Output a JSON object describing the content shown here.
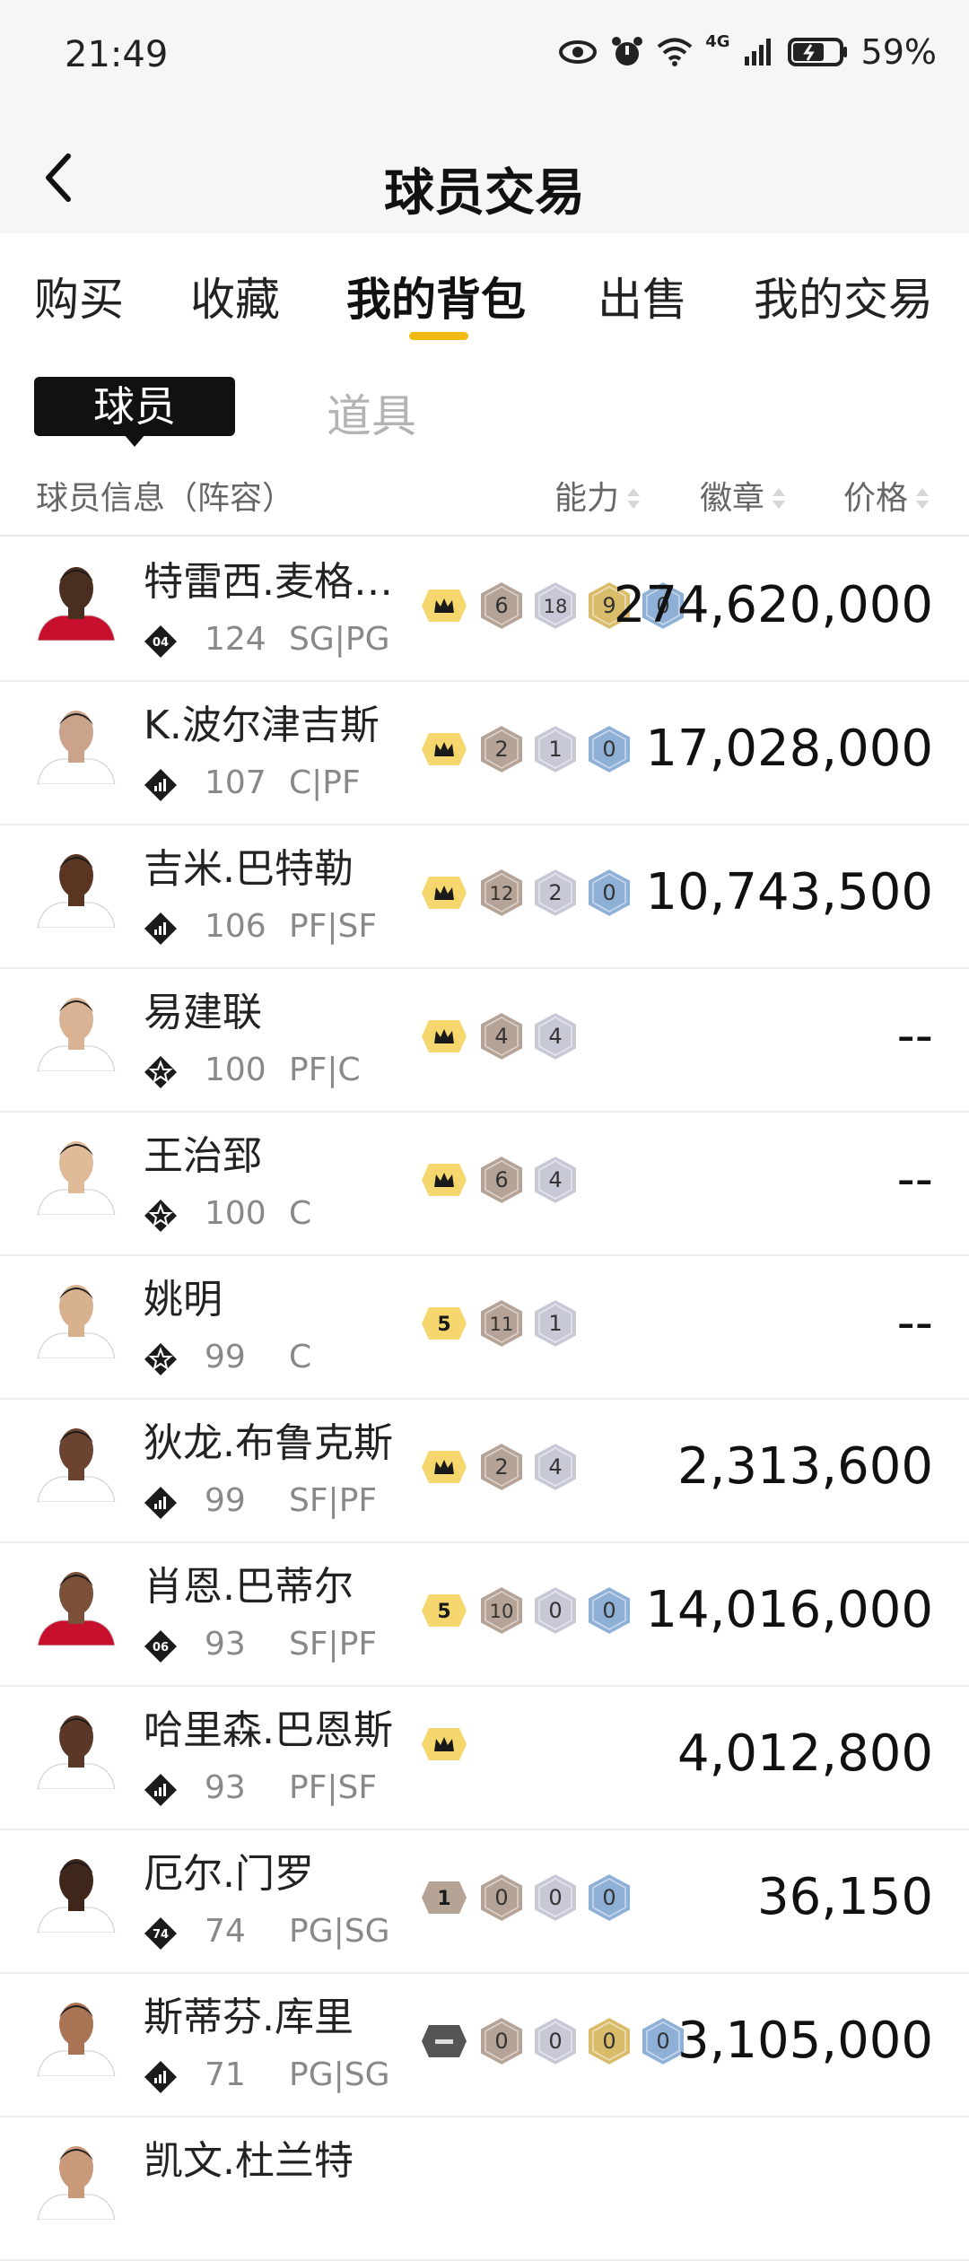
{
  "status_bar": {
    "time": "21:49",
    "battery": "59%",
    "network": "4G"
  },
  "header": {
    "title": "球员交易"
  },
  "tabs": [
    "购买",
    "收藏",
    "我的背包",
    "出售",
    "我的交易"
  ],
  "active_tab": 2,
  "segments": {
    "active": "球员",
    "inactive": "道具"
  },
  "columns": {
    "info": "球员信息（阵容）",
    "ability": "能力",
    "badge": "徽章",
    "price": "价格"
  },
  "colors": {
    "accent": "#f2b911",
    "bronze": "#b5a395",
    "silver": "#c7c9d6",
    "gold": "#d9bc6a",
    "blue": "#8fb0d6"
  },
  "players": [
    {
      "name": "特雷西.麦格雷...",
      "rating": "124",
      "pos": "SG|PG",
      "tier": "04",
      "lead": "crown",
      "badges": [
        {
          "t": "bronze",
          "n": "6"
        },
        {
          "t": "silver",
          "n": "18"
        },
        {
          "t": "gold",
          "n": "9"
        },
        {
          "t": "blue",
          "n": "0"
        }
      ],
      "price": "274,620,000"
    },
    {
      "name": "K.波尔津吉斯",
      "rating": "107",
      "pos": "C|PF",
      "tier": "bars",
      "lead": "crown",
      "badges": [
        {
          "t": "bronze",
          "n": "2"
        },
        {
          "t": "silver",
          "n": "1"
        },
        {
          "t": "blue",
          "n": "0"
        }
      ],
      "price": "17,028,000"
    },
    {
      "name": "吉米.巴特勒",
      "rating": "106",
      "pos": "PF|SF",
      "tier": "bars",
      "lead": "crown",
      "badges": [
        {
          "t": "bronze",
          "n": "12"
        },
        {
          "t": "silver",
          "n": "2"
        },
        {
          "t": "blue",
          "n": "0"
        }
      ],
      "price": "10,743,500"
    },
    {
      "name": "易建联",
      "rating": "100",
      "pos": "PF|C",
      "tier": "star",
      "lead": "crown",
      "badges": [
        {
          "t": "bronze",
          "n": "4"
        },
        {
          "t": "silver",
          "n": "4"
        }
      ],
      "price": "--"
    },
    {
      "name": "王治郅",
      "rating": "100",
      "pos": "C",
      "tier": "star",
      "lead": "crown",
      "badges": [
        {
          "t": "bronze",
          "n": "6"
        },
        {
          "t": "silver",
          "n": "4"
        }
      ],
      "price": "--"
    },
    {
      "name": "姚明",
      "rating": "99",
      "pos": "C",
      "tier": "star",
      "lead": "5",
      "badges": [
        {
          "t": "bronze",
          "n": "11"
        },
        {
          "t": "silver",
          "n": "1"
        }
      ],
      "price": "--"
    },
    {
      "name": "狄龙.布鲁克斯",
      "rating": "99",
      "pos": "SF|PF",
      "tier": "bars",
      "lead": "crown",
      "badges": [
        {
          "t": "bronze",
          "n": "2"
        },
        {
          "t": "silver",
          "n": "4"
        }
      ],
      "price": "2,313,600"
    },
    {
      "name": "肖恩.巴蒂尔",
      "rating": "93",
      "pos": "SF|PF",
      "tier": "06",
      "lead": "5",
      "badges": [
        {
          "t": "bronze",
          "n": "10"
        },
        {
          "t": "silver",
          "n": "0"
        },
        {
          "t": "blue",
          "n": "0"
        }
      ],
      "price": "14,016,000"
    },
    {
      "name": "哈里森.巴恩斯",
      "rating": "93",
      "pos": "PF|SF",
      "tier": "bars",
      "lead": "crown",
      "badges": [],
      "price": "4,012,800"
    },
    {
      "name": "厄尔.门罗",
      "rating": "74",
      "pos": "PG|SG",
      "tier": "74",
      "lead": "1",
      "badges": [
        {
          "t": "bronze",
          "n": "0"
        },
        {
          "t": "silver",
          "n": "0"
        },
        {
          "t": "blue",
          "n": "0"
        }
      ],
      "price": "36,150"
    },
    {
      "name": "斯蒂芬.库里",
      "rating": "71",
      "pos": "PG|SG",
      "tier": "bars",
      "lead": "dash",
      "badges": [
        {
          "t": "bronze",
          "n": "0"
        },
        {
          "t": "silver",
          "n": "0"
        },
        {
          "t": "gold",
          "n": "0"
        },
        {
          "t": "blue",
          "n": "0"
        }
      ],
      "price": "3,105,000"
    },
    {
      "name": "凯文.杜兰特",
      "rating": "",
      "pos": "",
      "tier": "",
      "lead": "",
      "badges": [],
      "price": ""
    }
  ]
}
